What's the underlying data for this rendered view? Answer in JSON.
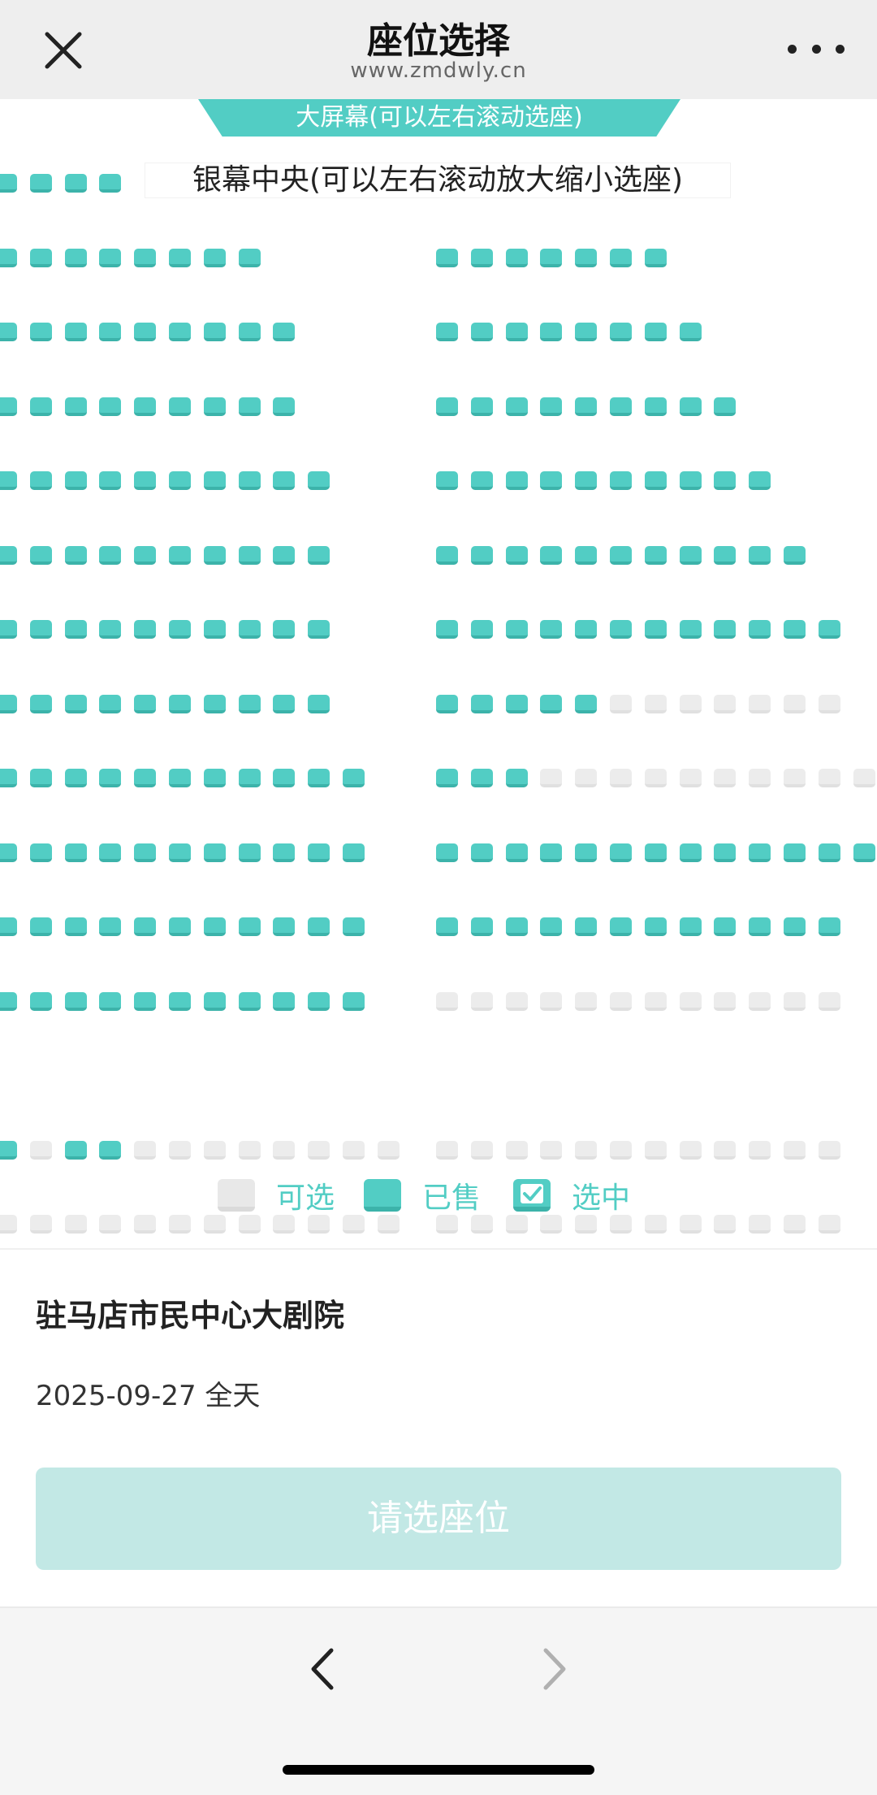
{
  "header": {
    "title": "座位选择",
    "domain": "www.zmdwly.cn",
    "close_icon": "close-icon",
    "more_icon": "more-icon"
  },
  "stage": {
    "banner": "大屏幕(可以左右滚动选座)",
    "center_label": "银幕中央(可以左右滚动放大缩小选座)"
  },
  "seat_colors": {
    "available": "#52cdc4",
    "sold": "#ececec",
    "accent": "#52cdc4",
    "button_disabled": "#c2e8e5"
  },
  "legend": {
    "available_label": "可选",
    "sold_label": "已售",
    "selected_label": "选中"
  },
  "event": {
    "venue": "驻马店市民中心大剧院",
    "date": "2025-09-27 全天"
  },
  "action": {
    "select_button": "请选座位"
  },
  "browser_nav": {
    "back_icon": "chevron-left-icon",
    "forward_icon": "chevron-right-icon"
  },
  "seat_rows": [
    {
      "left": "AAAA",
      "right": ""
    },
    {
      "left": "AAAAAAAA",
      "right": "AAAAAAA"
    },
    {
      "left": "AAAAAAAAA",
      "right": "AAAAAAAA"
    },
    {
      "left": "AAAAAAAAA",
      "right": "AAAAAAAAA"
    },
    {
      "left": "AAAAAAAAAA",
      "right": "AAAAAAAAAA"
    },
    {
      "left": "AAAAAAAAAA",
      "right": "AAAAAAAAAAA"
    },
    {
      "left": "AAAAAAAAAA",
      "right": "AAAAAAAAAAAA"
    },
    {
      "left": "AAAAAAAAAA",
      "right": "AAAAASSSSSSS"
    },
    {
      "left": "AAAAAAAAAAA",
      "right": "AAASSSSSSSSSS"
    },
    {
      "left": "AAAAAAAAAAA",
      "right": "AAAAAAAAAAAAA"
    },
    {
      "left": "AAAAAAAAAAA",
      "right": "AAAAAAAAAAAA"
    },
    {
      "left": "AAAAAAAAAAA",
      "right": "SSSSSSSSSSSS"
    },
    {
      "left": "",
      "right": ""
    },
    {
      "left": "ASAASSSSSSSS",
      "right": "SSSSSSSSSSSS"
    },
    {
      "left": "SSSSSSSSSSSS",
      "right": "SSSSSSSSSSSS"
    }
  ]
}
